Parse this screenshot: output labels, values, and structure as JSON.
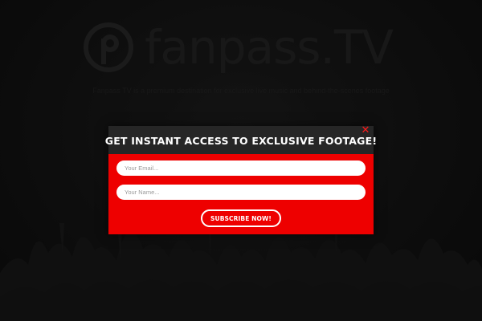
{
  "background": {
    "logo_text": "fanpass.TV",
    "tagline": "Fanpass TV is a premium destination for exclusive live music and behind-the-scenes footage"
  },
  "modal": {
    "title": "GET INSTANT ACCESS TO EXCLUSIVE FOOTAGE!",
    "close_glyph": "✕",
    "email_placeholder": "Your Email...",
    "name_placeholder": "Your Name...",
    "subscribe_label": "SUBSCRIBE NOW!"
  },
  "colors": {
    "modal_background": "#ee0000",
    "header_background": "#262626",
    "close_icon": "#ff1a1a",
    "page_background": "#141414"
  }
}
